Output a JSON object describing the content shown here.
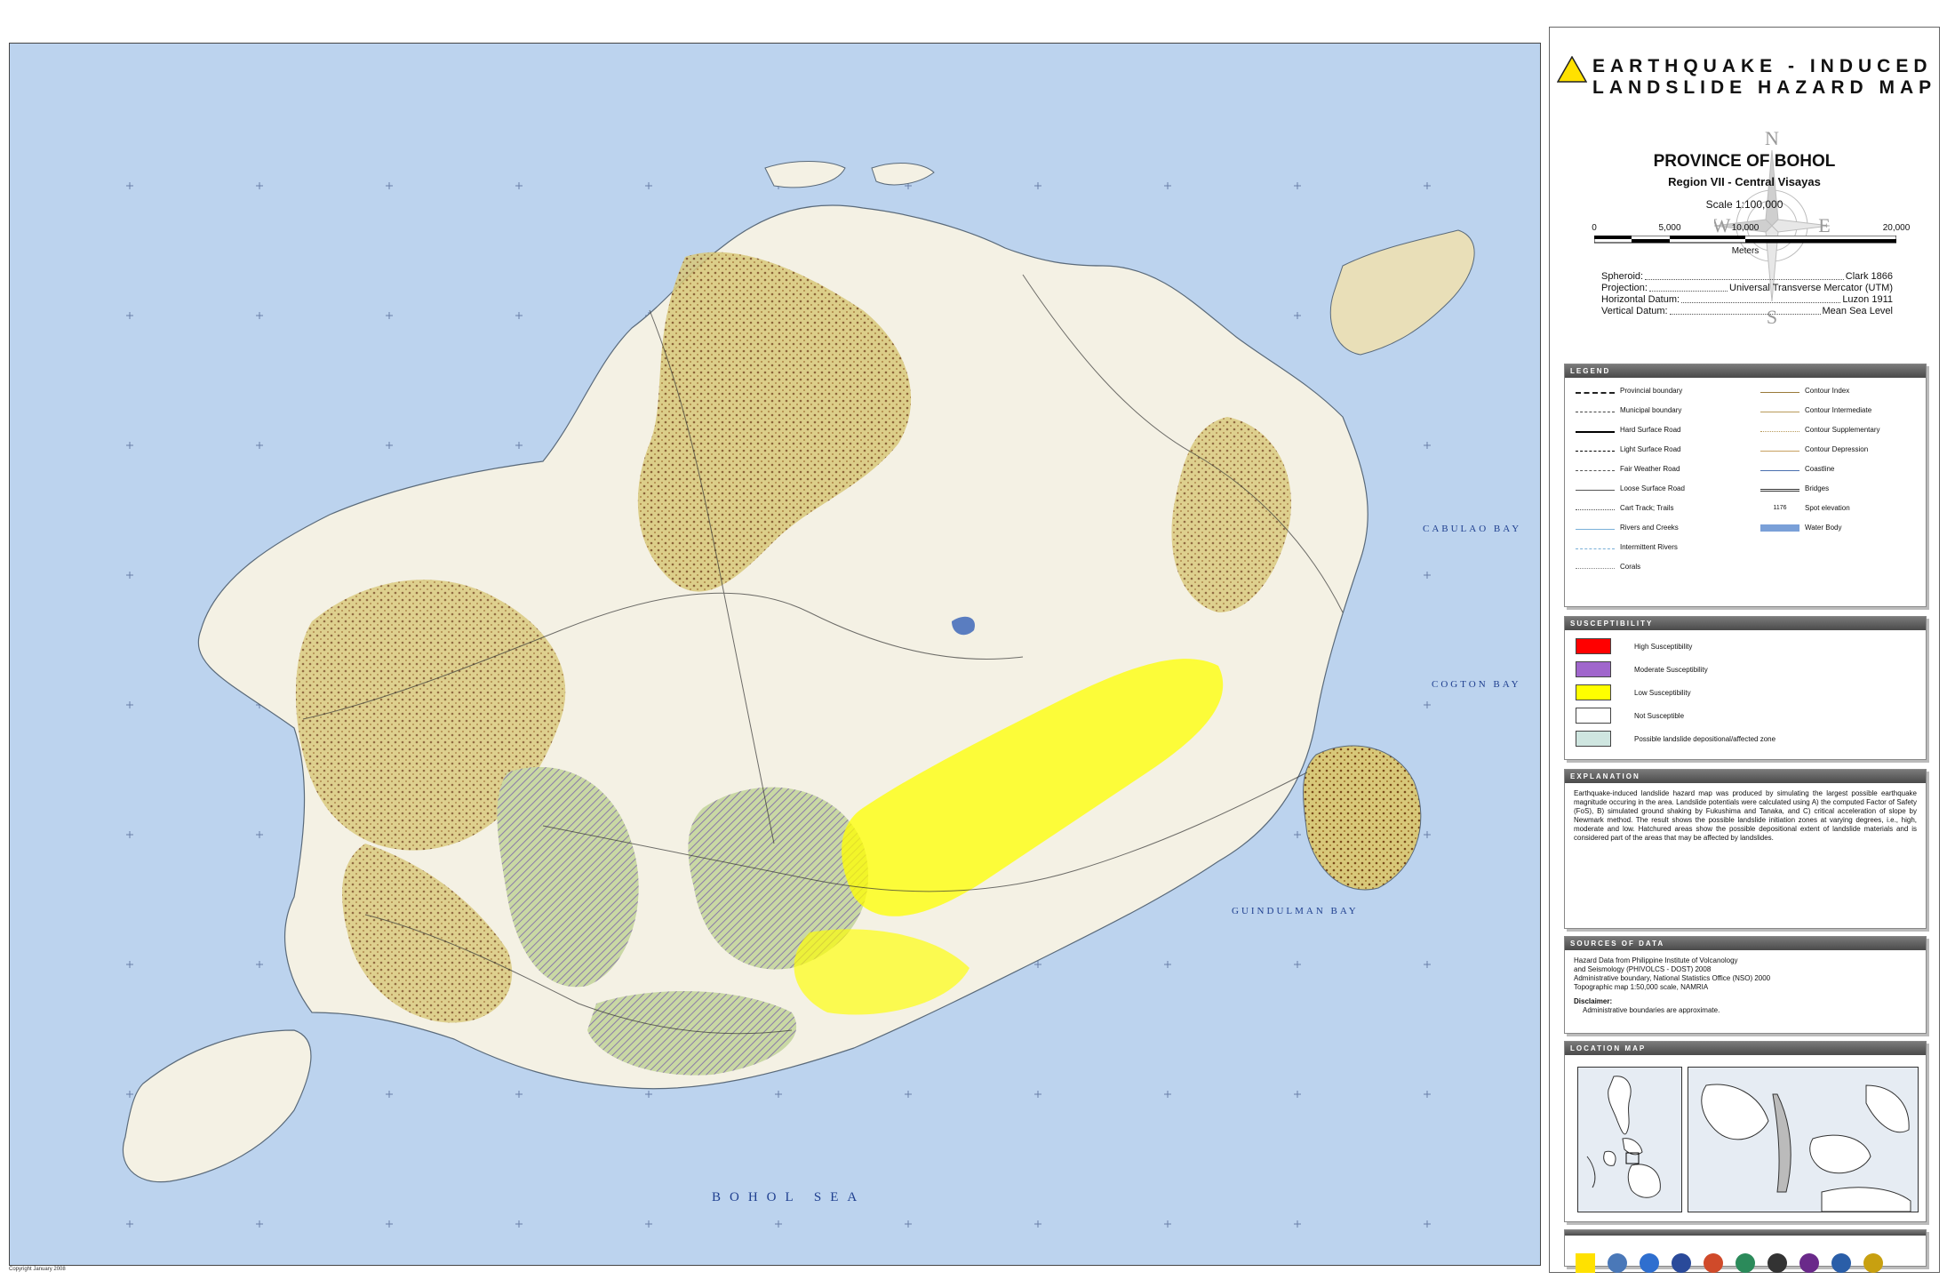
{
  "title": {
    "line1": "EARTHQUAKE - INDUCED",
    "line2": "LANDSLIDE  HAZARD MAP",
    "icon": "landslide-warning-icon"
  },
  "province": "PROVINCE OF BOHOL",
  "region": "Region VII - Central Visayas",
  "scale": {
    "label": "Scale 1:100,000",
    "ticks": [
      "0",
      "5,000",
      "10,000",
      "20,000"
    ],
    "unit": "Meters"
  },
  "compass": {
    "n": "N",
    "e": "E",
    "s": "S",
    "w": "W"
  },
  "geodetic": [
    {
      "k": "Spheroid:",
      "v": "Clark 1866"
    },
    {
      "k": "Projection:",
      "v": "Universal Transverse Mercator (UTM)"
    },
    {
      "k": "Horizontal Datum:",
      "v": "Luzon 1911"
    },
    {
      "k": "Vertical Datum:",
      "v": "Mean Sea Level"
    }
  ],
  "legend": {
    "heading": "LEGEND",
    "left": [
      "Provincial boundary",
      "Municipal boundary",
      "Hard Surface Road",
      "Light Surface Road",
      "Fair Weather Road",
      "Loose Surface Road",
      "Cart Track; Trails",
      "Rivers and Creeks",
      "Intermittent Rivers",
      "Corals"
    ],
    "right": [
      "Contour Index",
      "Contour Intermediate",
      "Contour Supplementary",
      "Contour Depression",
      "Coastline",
      "Bridges",
      "Spot elevation",
      "Water Body"
    ],
    "spot_value": "1176"
  },
  "susceptibility": {
    "heading": "SUSCEPTIBILITY",
    "items": [
      {
        "label": "High Susceptibility",
        "color": "#ff0000"
      },
      {
        "label": "Moderate Susceptibility",
        "color": "#a066cc"
      },
      {
        "label": "Low Susceptibility",
        "color": "#ffff00"
      },
      {
        "label": "Not Susceptible",
        "color": "#ffffff"
      },
      {
        "label": "Possible landslide depositional/affected zone",
        "color": "#cfe6e0"
      }
    ]
  },
  "explanation": {
    "heading": "EXPLANATION",
    "text": "Earthquake-induced landslide hazard map was produced by simulating the largest possible earthquake magnitude occuring in the area. Landslide potentials were calculated using A) the computed Factor of Safety (FoS), B) simulated ground shaking by Fukushima and Tanaka, and C) critical acceleration of slope by Newmark method. The result shows the possible landslide initiation zones at varying degrees, i.e., high, moderate and low. Hatchured areas show the possible depositional extent of landslide materials and is considered part of the areas that may be affected by landslides."
  },
  "sources": {
    "heading": "SOURCES OF DATA",
    "lines": [
      "Hazard Data from Philippine Institute of Volcanology",
      "and Seismology (PHIVOLCS - DOST) 2008",
      "Administrative boundary, National Statistics Office (NSO) 2000",
      "Topographic map 1:50,000 scale, NAMRIA"
    ],
    "disclaimer_label": "Disclaimer:",
    "disclaimer": "Administrative boundaries are approximate."
  },
  "location_map": {
    "heading": "LOCATION MAP"
  },
  "sea_labels": {
    "bohol_sea": "BOHOL SEA",
    "cabulao_bay": "CABULAO BAY",
    "cogton_bay": "COGTON BAY",
    "guindulman_bay": "GUINDULMAN BAY"
  },
  "copyright": "Copyright January 2008",
  "colors": {
    "sea": "#bcd3ee",
    "land": "#f4f1e4",
    "moderate_hillside": "#d6c26a",
    "low": "#ffff00",
    "high": "#ff0000",
    "deposition_hatch": "#a0b870"
  }
}
